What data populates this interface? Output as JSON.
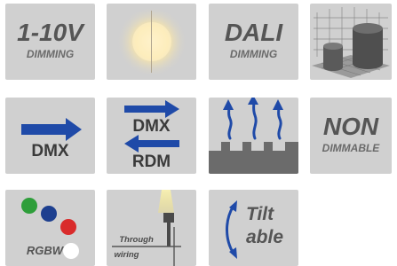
{
  "tiles": {
    "dim110": {
      "line1": "1-10V",
      "line2": "DIMMING"
    },
    "warmcool": {},
    "dali": {
      "line1": "DALI",
      "line2": "DIMMING"
    },
    "cylinders": {},
    "dmx": {
      "label": "DMX"
    },
    "dmxrdm": {
      "line1": "DMX",
      "line2": "RDM"
    },
    "heatsink": {},
    "nondim": {
      "line1": "NON",
      "line2": "DIMMABLE"
    },
    "rgbw": {
      "label": "RGBW",
      "dot_colors": [
        "#2e9e3a",
        "#1d3f8f",
        "#d92b2b",
        "#ffffff"
      ]
    },
    "through": {
      "line1": "Through",
      "line2": "wiring"
    },
    "tilt": {
      "line1": "Tilt",
      "line2": "able"
    }
  },
  "colors": {
    "tile_bg": "#d0d0d0",
    "text_gray": "#555555",
    "arrow_blue": "#1f4aa8",
    "text_dark": "#3a3a3a"
  }
}
